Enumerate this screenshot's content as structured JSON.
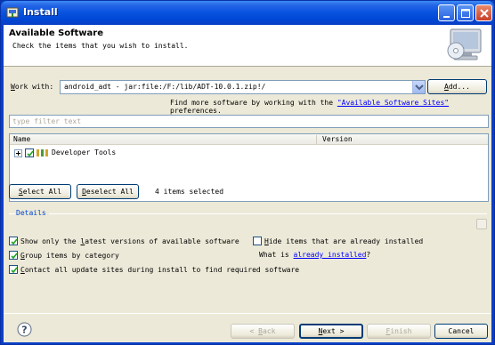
{
  "window": {
    "title": "Install",
    "icon": "install-icon",
    "controls": [
      "minimize-icon",
      "maximize-icon",
      "close-icon"
    ]
  },
  "header": {
    "title": "Available Software",
    "description": "Check the items that you wish to install.",
    "image": "monitor-cd-icon"
  },
  "work_with": {
    "label_accel": "W",
    "label_rest": "ork with:",
    "value": "android_adt - jar:file:/F:/lib/ADT-10.0.1.zip!/",
    "add_accel": "A",
    "add_rest": "dd..."
  },
  "find_more": {
    "prefix": "Find more software by working with the ",
    "link": "\"Available Software Sites\"",
    "suffix": " preferences."
  },
  "filter": {
    "placeholder": "type filter text"
  },
  "tree": {
    "columns": [
      "Name",
      "Version"
    ],
    "rows": [
      {
        "expander": "+",
        "checked": true,
        "icon": "feature-group-icon",
        "name": "Developer Tools",
        "version": ""
      }
    ]
  },
  "selection": {
    "select_all_accel": "S",
    "select_all_rest": "elect All",
    "deselect_all_accel": "D",
    "deselect_all_rest": "eselect All",
    "count_text": "4 items selected"
  },
  "details": {
    "label": "Details"
  },
  "options": {
    "show_latest": {
      "checked": true,
      "pre": "Show only the ",
      "accel": "l",
      "post": "atest versions of available software"
    },
    "hide_installed": {
      "checked": false,
      "accel": "H",
      "post": "ide items that are already installed"
    },
    "group_by_category": {
      "checked": true,
      "accel": "G",
      "post": "roup items by category"
    },
    "what_is": {
      "prefix": "What is ",
      "link": "already installed",
      "suffix": "?"
    },
    "contact_sites": {
      "checked": true,
      "accel": "C",
      "post": "ontact all update sites during install to find required software"
    }
  },
  "footer": {
    "help_icon": "help-icon",
    "back_pre": "< ",
    "back_accel": "B",
    "back_post": "ack",
    "next_accel": "N",
    "next_post": "ext >",
    "finish_accel": "F",
    "finish_post": "inish",
    "cancel": "Cancel"
  },
  "colors": {
    "titlebar": "#0a55e0",
    "dialog_bg": "#ece9d8",
    "link": "#0000ff",
    "details_label": "#0046d5"
  }
}
